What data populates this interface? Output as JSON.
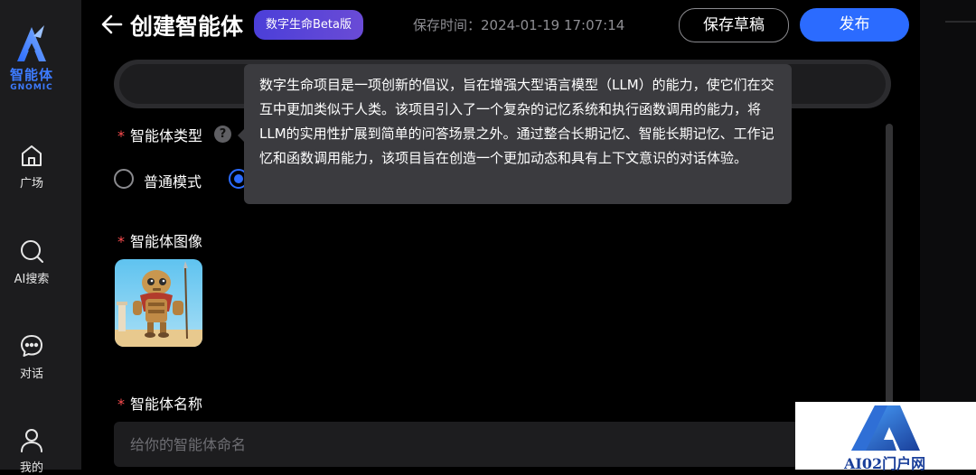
{
  "sidebar": {
    "logo_cn": "智能体",
    "logo_en": "GNOMIC",
    "items": [
      {
        "label": "广场",
        "icon": "home-icon"
      },
      {
        "label": "AI搜索",
        "icon": "search-icon"
      },
      {
        "label": "对话",
        "icon": "chat-icon"
      },
      {
        "label": "我的",
        "icon": "user-icon"
      }
    ]
  },
  "header": {
    "title": "创建智能体",
    "badge": "数字生命Beta版",
    "save_time": "保存时间：2024-01-19 17:07:14",
    "draft_label": "保存草稿",
    "publish_label": "发布"
  },
  "form": {
    "type_label": "智能体类型",
    "modes": [
      "普通模式"
    ],
    "image_label": "智能体图像",
    "name_label": "智能体名称",
    "name_placeholder": "给你的智能体命名",
    "name_value": ""
  },
  "tooltip": {
    "text": "数字生命项目是一项创新的倡议，旨在增强大型语言模型（LLM）的能力，使它们在交互中更加类似于人类。该项目引入了一个复杂的记忆系统和执行函数调用的能力，将LLM的实用性扩展到简单的问答场景之外。通过整合长期记忆、智能长期记忆、工作记忆和函数调用能力，该项目旨在创造一个更加动态和具有上下文意识的对话体验。"
  },
  "watermark": {
    "text": "AI02门户网"
  },
  "colors": {
    "accent": "#2b6bff",
    "badge_gradient_start": "#4b3fd8",
    "required": "#ff4d4f",
    "sidebar_bg": "#1c1c1e",
    "tooltip_bg": "#3b3b3f"
  }
}
